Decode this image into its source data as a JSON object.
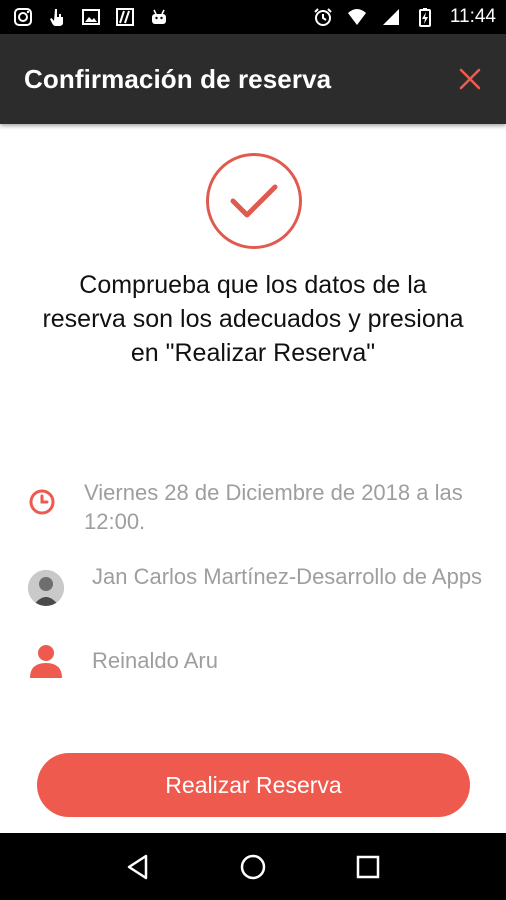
{
  "status_bar": {
    "time": "11:44",
    "left_icons": [
      "instagram-icon",
      "touch-icon",
      "image-icon",
      "fabric-icon",
      "android-icon"
    ],
    "right_icons": [
      "alarm-icon",
      "wifi-icon",
      "signal-icon",
      "battery-charging-icon"
    ]
  },
  "app_bar": {
    "title": "Confirmación de reserva",
    "close_icon": "close-icon"
  },
  "confirmation": {
    "instructions": "Comprueba que los datos de la reserva son los adecuados y presiona en \"Realizar Reserva\""
  },
  "details": {
    "date": "Viernes 28 de Diciembre de 2018 a las 12:00.",
    "professional": "Jan Carlos Martínez-Desarrollo de Apps",
    "client": "Reinaldo Aru"
  },
  "cta": {
    "label": "Realizar Reserva"
  },
  "colors": {
    "accent": "#ef5a4e",
    "app_bar": "#2c2c2c",
    "detail_text": "#9e9e9e"
  }
}
